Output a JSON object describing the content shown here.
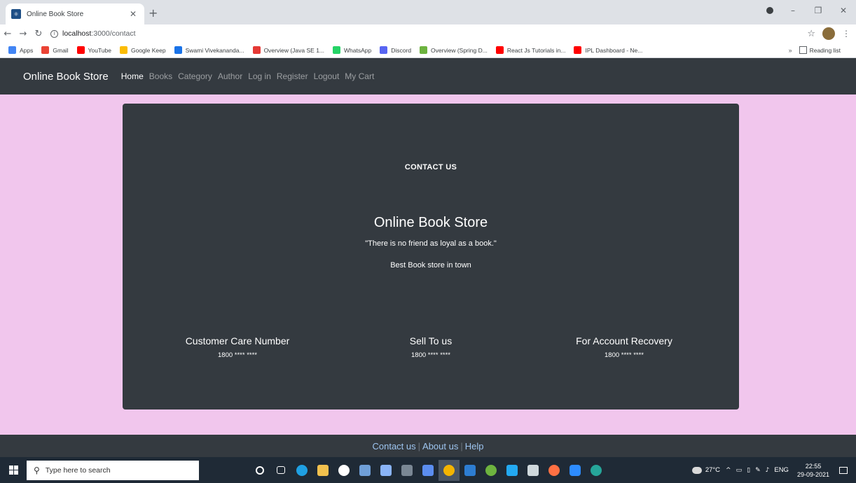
{
  "browser": {
    "tab_title": "Online Book Store",
    "url_host": "localhost",
    "url_path": ":3000/contact",
    "bookmarks": [
      {
        "label": "Apps",
        "color": "#4285f4"
      },
      {
        "label": "Gmail",
        "color": "#ea4335"
      },
      {
        "label": "YouTube",
        "color": "#ff0000"
      },
      {
        "label": "Google Keep",
        "color": "#fbbc04"
      },
      {
        "label": "Swami Vivekananda...",
        "color": "#1a73e8"
      },
      {
        "label": "Overview (Java SE 1...",
        "color": "#e53935"
      },
      {
        "label": "WhatsApp",
        "color": "#25d366"
      },
      {
        "label": "Discord",
        "color": "#5865f2"
      },
      {
        "label": "Overview (Spring D...",
        "color": "#6db33f"
      },
      {
        "label": "React Js Tutorials in...",
        "color": "#ff0000"
      },
      {
        "label": "IPL Dashboard - Ne...",
        "color": "#ff0000"
      }
    ],
    "bookmarks_overflow": "»",
    "reading_list": "Reading list"
  },
  "navbar": {
    "brand": "Online Book Store",
    "links": [
      "Home",
      "Books",
      "Category",
      "Author",
      "Log in",
      "Register",
      "Logout",
      "My Cart"
    ]
  },
  "contact": {
    "heading": "CONTACT US",
    "store_name": "Online Book Store",
    "quote": "\"There is no friend as loyal as a book.\"",
    "tagline": "Best Book store in town",
    "columns": [
      {
        "title": "Customer Care Number",
        "value": "1800 **** ****"
      },
      {
        "title": "Sell To us",
        "value": "1800 **** ****"
      },
      {
        "title": "For Account Recovery",
        "value": "1800 **** ****"
      }
    ]
  },
  "footer": {
    "links": [
      "Contact us",
      "About us",
      "Help"
    ],
    "separator": "|"
  },
  "taskbar": {
    "search_placeholder": "Type here to search",
    "weather": "27°C",
    "language": "ENG",
    "time": "22:55",
    "date": "29-09-2021"
  },
  "colors": {
    "page_bg": "#f1c6ed",
    "dark": "#343a40",
    "footer_link": "#9ec5f0"
  }
}
